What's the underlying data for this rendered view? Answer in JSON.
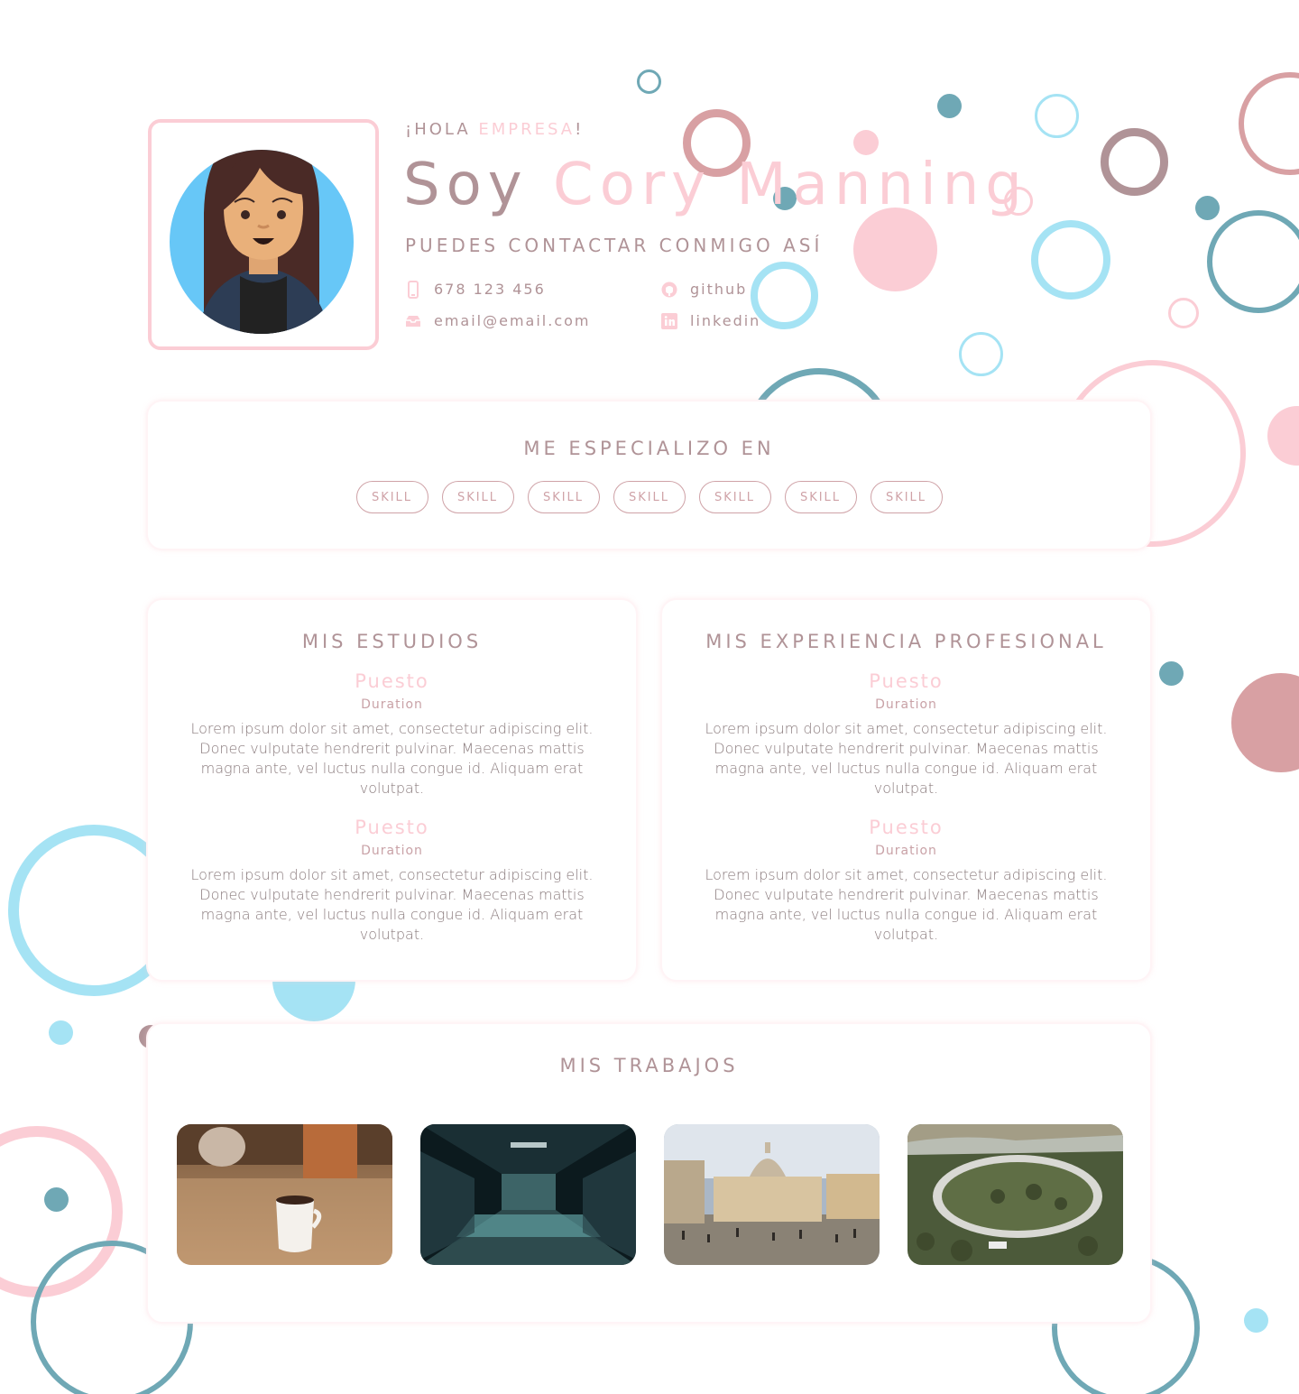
{
  "header": {
    "greeting_prefix": "¡HOLA ",
    "greeting_accent": "EMPRESA",
    "greeting_suffix": "!",
    "headline_prefix": "Soy ",
    "headline_name": "Cory Manning",
    "contact_title": "PUEDES CONTACTAR CONMIGO ASÍ",
    "contacts": [
      {
        "icon": "phone-icon",
        "label": "678 123 456"
      },
      {
        "icon": "email-icon",
        "label": "email@email.com"
      },
      {
        "icon": "github-icon",
        "label": "github"
      },
      {
        "icon": "linkedin-icon",
        "label": "linkedin"
      }
    ]
  },
  "skills": {
    "title": "ME ESPECIALIZO EN",
    "items": [
      "SKILL",
      "SKILL",
      "SKILL",
      "SKILL",
      "SKILL",
      "SKILL",
      "SKILL"
    ]
  },
  "studies": {
    "title": "MIS ESTUDIOS",
    "entries": [
      {
        "puesto": "Puesto",
        "duration": "Duration",
        "desc": "Lorem ipsum dolor sit amet, consectetur adipiscing elit. Donec vulputate hendrerit pulvinar. Maecenas mattis magna ante, vel luctus nulla congue id. Aliquam erat volutpat."
      },
      {
        "puesto": "Puesto",
        "duration": "Duration",
        "desc": "Lorem ipsum dolor sit amet, consectetur adipiscing elit. Donec vulputate hendrerit pulvinar. Maecenas mattis magna ante, vel luctus nulla congue id. Aliquam erat volutpat."
      }
    ]
  },
  "experience": {
    "title": "MIS EXPERIENCIA PROFESIONAL",
    "entries": [
      {
        "puesto": "Puesto",
        "duration": "Duration",
        "desc": "Lorem ipsum dolor sit amet, consectetur adipiscing elit. Donec vulputate hendrerit pulvinar. Maecenas mattis magna ante, vel luctus nulla congue id. Aliquam erat volutpat."
      },
      {
        "puesto": "Puesto",
        "duration": "Duration",
        "desc": "Lorem ipsum dolor sit amet, consectetur adipiscing elit. Donec vulputate hendrerit pulvinar. Maecenas mattis magna ante, vel luctus nulla congue id. Aliquam erat volutpat."
      }
    ]
  },
  "works": {
    "title": "MIS TRABAJOS",
    "items": [
      "coffee-cup-photo",
      "glass-corridor-photo",
      "basilica-square-photo",
      "circular-campus-photo"
    ]
  },
  "colors": {
    "pink": "#fbcdd5",
    "mauve": "#b09397",
    "teal": "#6fa8b5",
    "light_blue": "#a5e3f4",
    "rose": "#d8a0a3"
  }
}
